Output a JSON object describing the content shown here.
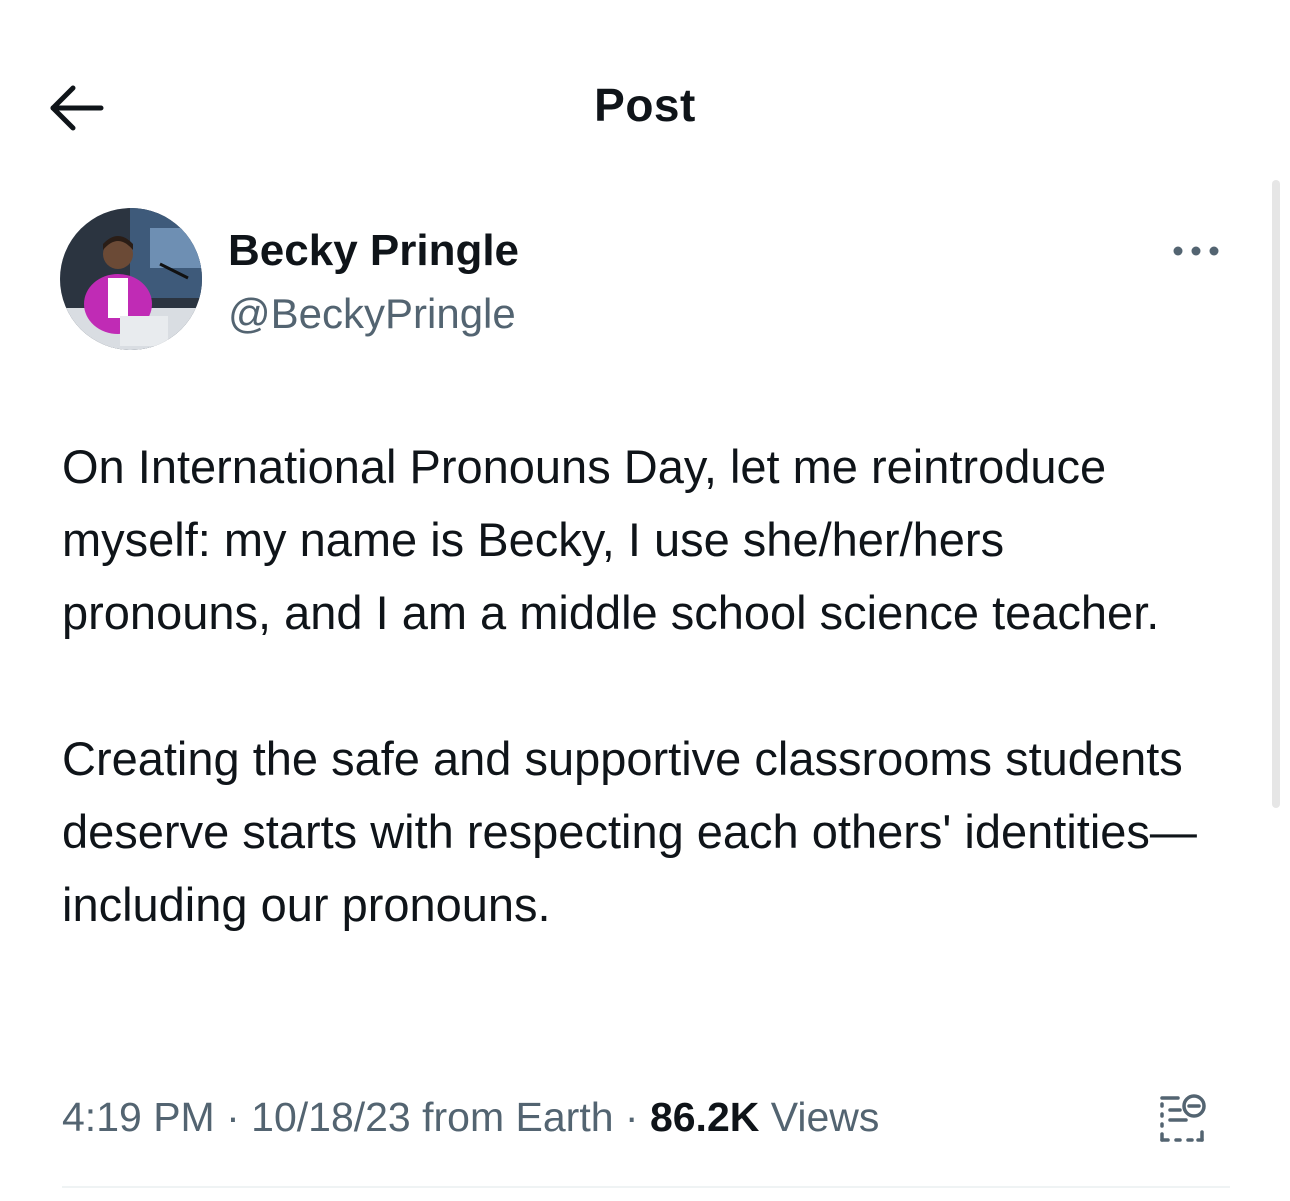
{
  "header": {
    "title": "Post",
    "back_icon": "arrow-left-icon"
  },
  "author": {
    "display_name": "Becky Pringle",
    "handle": "@BeckyPringle",
    "more_icon": "more-horizontal-icon"
  },
  "tweet": {
    "paragraphs": [
      "On International Pronouns Day, let me reintroduce myself: my name is Becky, I use she/her/hers pronouns, and I am a middle school science teacher.",
      "Creating the safe and supportive classrooms students deserve starts with respecting each others' identities—including our pronouns."
    ]
  },
  "meta": {
    "time": "4:19 PM",
    "sep1": " · ",
    "date_source": "10/18/23 from Earth",
    "sep2": " · ",
    "views_count": "86.2K",
    "views_label": " Views",
    "analytics_icon": "post-analytics-icon"
  },
  "colors": {
    "text_primary": "#0f1419",
    "text_secondary": "#536471",
    "divider": "#eff3f4",
    "avatar_accent": "#c02bb5"
  }
}
